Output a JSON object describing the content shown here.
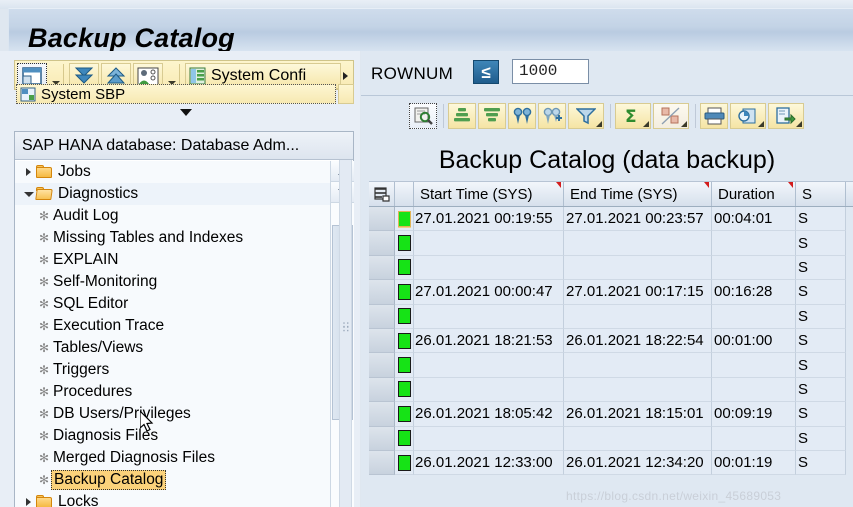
{
  "window": {
    "title": "Backup Catalog"
  },
  "left_panel": {
    "toolbar": {
      "buttons": [
        {
          "name": "layout-icon",
          "label": ""
        },
        {
          "name": "collapse-all-icon",
          "label": ""
        },
        {
          "name": "expand-all-icon",
          "label": ""
        },
        {
          "name": "user-icon",
          "label": ""
        }
      ],
      "system_config_label": "System Confi",
      "more_label": "▸"
    },
    "toolbar2": {
      "label": "System SBP"
    },
    "tree": {
      "header": "SAP HANA database: Database Adm...",
      "items": [
        {
          "label": "Jobs",
          "type": "folder",
          "expanded": false,
          "indent": 0
        },
        {
          "label": "Diagnostics",
          "type": "folder",
          "expanded": true,
          "indent": 0
        },
        {
          "label": "Audit Log",
          "type": "leaf",
          "indent": 1
        },
        {
          "label": "Missing Tables and Indexes",
          "type": "leaf",
          "indent": 1
        },
        {
          "label": "EXPLAIN",
          "type": "leaf",
          "indent": 1
        },
        {
          "label": "Self-Monitoring",
          "type": "leaf",
          "indent": 1
        },
        {
          "label": "SQL Editor",
          "type": "leaf",
          "indent": 1
        },
        {
          "label": "Execution Trace",
          "type": "leaf",
          "indent": 1
        },
        {
          "label": "Tables/Views",
          "type": "leaf",
          "indent": 1
        },
        {
          "label": "Triggers",
          "type": "leaf",
          "indent": 1
        },
        {
          "label": "Procedures",
          "type": "leaf",
          "indent": 1
        },
        {
          "label": "DB Users/Privileges",
          "type": "leaf",
          "indent": 1
        },
        {
          "label": "Diagnosis Files",
          "type": "leaf",
          "indent": 1
        },
        {
          "label": "Merged Diagnosis Files",
          "type": "leaf",
          "indent": 1
        },
        {
          "label": "Backup Catalog",
          "type": "leaf",
          "indent": 1,
          "selected": true
        },
        {
          "label": "Locks",
          "type": "folder",
          "expanded": false,
          "indent": 0
        }
      ]
    }
  },
  "right_panel": {
    "rownum": {
      "label": "ROWNUM",
      "operator": "≤",
      "value": "1000"
    },
    "grid_toolbar": {
      "buttons": [
        {
          "name": "details-icon"
        },
        {
          "name": "sort-ascending-icon"
        },
        {
          "name": "sort-descending-icon"
        },
        {
          "name": "find-icon"
        },
        {
          "name": "find-next-icon"
        },
        {
          "name": "filter-icon"
        },
        {
          "name": "total-sum-icon"
        },
        {
          "name": "subtotal-icon"
        },
        {
          "name": "print-icon"
        },
        {
          "name": "print-preview-icon"
        },
        {
          "name": "export-icon"
        }
      ]
    },
    "grid_title": "Backup Catalog (data backup)",
    "table": {
      "columns": [
        "Start Time (SYS)",
        "End Time (SYS)",
        "Duration",
        "S"
      ],
      "rows": [
        {
          "status": "green",
          "highlight": true,
          "start": "27.01.2021 00:19:55",
          "end": "27.01.2021 00:23:57",
          "duration": "00:04:01",
          "size": "S"
        },
        {
          "status": "green",
          "start": "",
          "end": "",
          "duration": "",
          "size": "S"
        },
        {
          "status": "green",
          "start": "",
          "end": "",
          "duration": "",
          "size": "S"
        },
        {
          "status": "green",
          "start": "27.01.2021 00:00:47",
          "end": "27.01.2021 00:17:15",
          "duration": "00:16:28",
          "size": "S"
        },
        {
          "status": "green",
          "start": "",
          "end": "",
          "duration": "",
          "size": "S"
        },
        {
          "status": "green",
          "start": "26.01.2021 18:21:53",
          "end": "26.01.2021 18:22:54",
          "duration": "00:01:00",
          "size": "S"
        },
        {
          "status": "green",
          "start": "",
          "end": "",
          "duration": "",
          "size": "S"
        },
        {
          "status": "green",
          "start": "",
          "end": "",
          "duration": "",
          "size": "S"
        },
        {
          "status": "green",
          "start": "26.01.2021 18:05:42",
          "end": "26.01.2021 18:15:01",
          "duration": "00:09:19",
          "size": "S"
        },
        {
          "status": "green",
          "start": "",
          "end": "",
          "duration": "",
          "size": "S"
        },
        {
          "status": "green",
          "start": "26.01.2021 12:33:00",
          "end": "26.01.2021 12:34:20",
          "duration": "00:01:19",
          "size": "S"
        }
      ]
    }
  },
  "watermark": "https://blog.csdn.net/weixin_45689053",
  "colors": {
    "title_band": "#c3d3e6",
    "toolbar_yellow": "#f6e6a8",
    "selection_orange": "#fbd27b",
    "status_green": "#16e316",
    "accent_blue": "#1f5c8c",
    "grid_row": "#e3ebf5"
  }
}
